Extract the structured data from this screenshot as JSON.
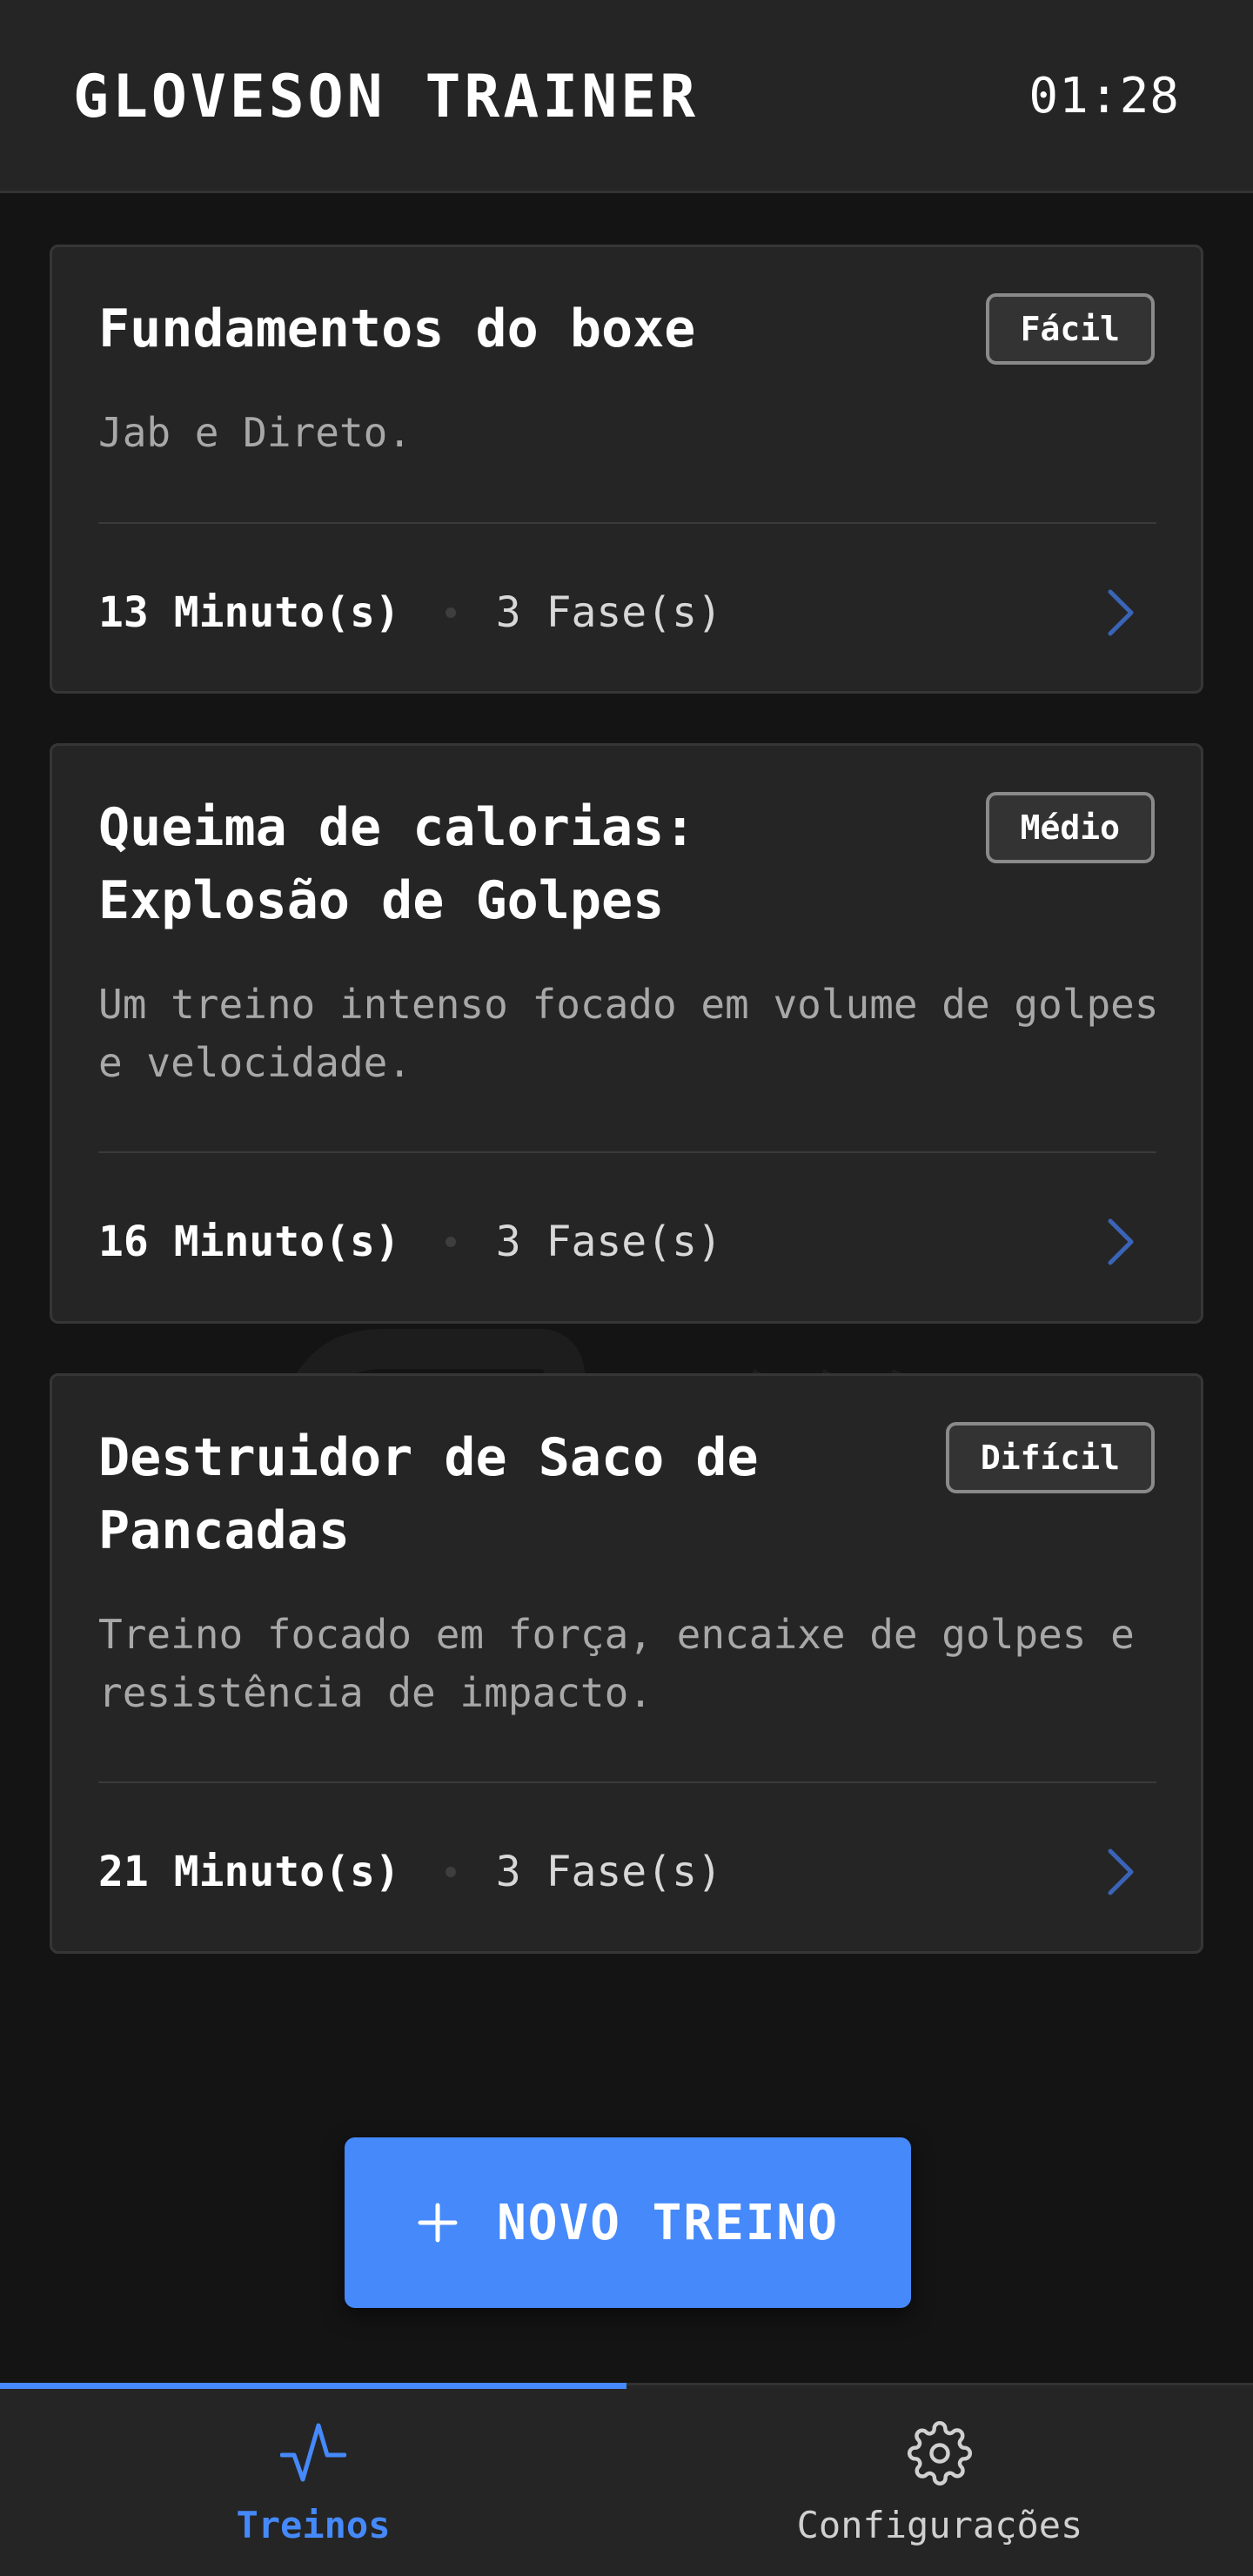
{
  "header": {
    "title": "GLOVESON TRAINER",
    "time": "01:28"
  },
  "workouts": [
    {
      "title": "Fundamentos do boxe",
      "difficulty": "Fácil",
      "description": "Jab e Direto.",
      "minutes": "13 Minuto(s)",
      "phases": "3 Fase(s)"
    },
    {
      "title": "Queima de calorias: Explosão de Golpes",
      "difficulty": "Médio",
      "description": "Um treino intenso focado em volume de golpes e velocidade.",
      "minutes": "16 Minuto(s)",
      "phases": "3 Fase(s)"
    },
    {
      "title": "Destruidor de Saco de Pancadas",
      "difficulty": "Difícil",
      "description": "Treino focado em força, encaixe de golpes e resistência de impacto.",
      "minutes": "21 Minuto(s)",
      "phases": "3 Fase(s)"
    }
  ],
  "new_workout_button": {
    "label": "NOVO TREINO",
    "icon": "plus-icon"
  },
  "bottom_nav": {
    "items": [
      {
        "label": "Treinos",
        "icon": "activity-icon",
        "active": true
      },
      {
        "label": "Configurações",
        "icon": "gear-icon",
        "active": false
      }
    ]
  },
  "colors": {
    "accent": "#4589fa",
    "background": "#141414",
    "surface": "#252525",
    "chevron": "#3a64b8"
  }
}
